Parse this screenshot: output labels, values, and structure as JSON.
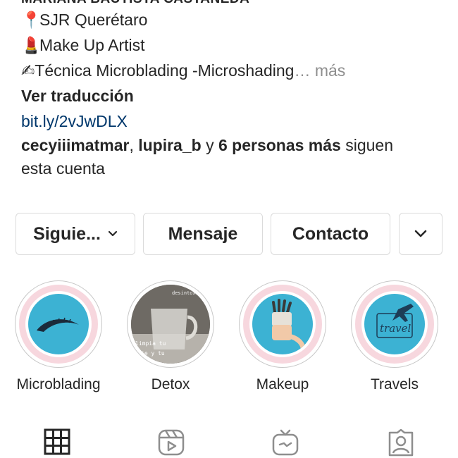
{
  "profile": {
    "name": "MARIANA BAUTISTA CASTAÑEDA",
    "bio_lines": [
      {
        "emoji": "📍",
        "text": "SJR Querétaro"
      },
      {
        "emoji": "💄",
        "text": "Make Up Artist"
      }
    ],
    "bio_line3_prefix": "✍",
    "bio_line3_text": "Técnica Microblading -Microshading",
    "bio_more": "… más",
    "translate": "Ver traducción",
    "link": "bit.ly/2vJwDLX",
    "followed_by": {
      "user1": "cecyiiimatmar",
      "sep": ", ",
      "user2": "lupira_b",
      "and": " y ",
      "others": "6 personas más",
      "suffix": " siguen",
      "line2": "esta cuenta"
    }
  },
  "actions": {
    "following": "Siguie...",
    "message": "Mensaje",
    "contact": "Contacto"
  },
  "highlights": [
    {
      "label": "Microblading",
      "icon": "eyebrow-icon"
    },
    {
      "label": "Detox",
      "icon": "glass-photo",
      "overlay_top": "desintoxica",
      "overlay_bottom1": "limpia tu",
      "overlay_bottom2": "te y tu"
    },
    {
      "label": "Makeup",
      "icon": "makeup-brushes-icon"
    },
    {
      "label": "Travels",
      "icon": "travel-plane-icon",
      "overlay_text": "travel"
    }
  ],
  "tabs": [
    "grid-icon",
    "reels-icon",
    "igtv-icon",
    "tagged-icon"
  ],
  "colors": {
    "text": "#262626",
    "link": "#00376b",
    "muted": "#8e8e8e",
    "highlight_blue": "#3cb2d3",
    "highlight_pink": "#f7d7de"
  }
}
